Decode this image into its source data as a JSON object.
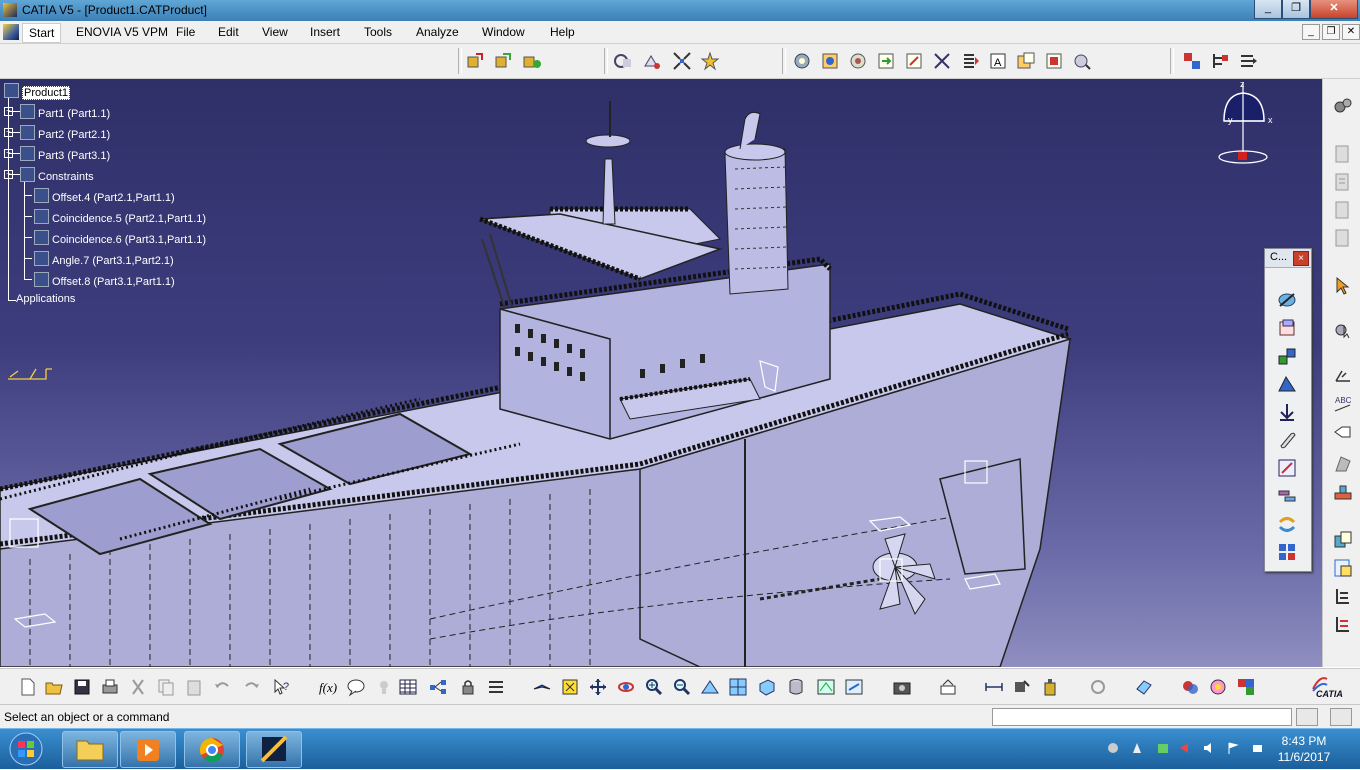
{
  "window": {
    "title": "CATIA V5 - [Product1.CATProduct]",
    "controls": [
      "minimize",
      "restore",
      "close"
    ]
  },
  "menu": {
    "items": [
      "Start",
      "ENOVIA V5 VPM",
      "File",
      "Edit",
      "View",
      "Insert",
      "Tools",
      "Analyze",
      "Window",
      "Help"
    ]
  },
  "tree": {
    "root": "Product1",
    "parts": [
      "Part1 (Part1.1)",
      "Part2 (Part2.1)",
      "Part3 (Part3.1)"
    ],
    "constraints_label": "Constraints",
    "constraints": [
      "Offset.4 (Part2.1,Part1.1)",
      "Coincidence.5 (Part2.1,Part1.1)",
      "Coincidence.6 (Part3.1,Part1.1)",
      "Angle.7 (Part3.1,Part2.1)",
      "Offset.8 (Part3.1,Part1.1)"
    ],
    "applications_label": "Applications"
  },
  "compass": {
    "axes": [
      "x",
      "y",
      "z"
    ]
  },
  "floating_toolbar": {
    "title": "C...",
    "close": "×"
  },
  "statusbar": {
    "message": "Select an object or a command"
  },
  "brand": {
    "logo_text": "CATIA"
  },
  "taskbar": {
    "time": "8:43 PM",
    "date": "11/6/2017",
    "apps": [
      "file-explorer",
      "media-player",
      "chrome",
      "catia"
    ]
  },
  "colors": {
    "viewport_top": "#2f2f68",
    "viewport_bottom": "#8e8ec0",
    "ship_fill": "#b9b9df",
    "taskbar": "#1b5f9c"
  }
}
